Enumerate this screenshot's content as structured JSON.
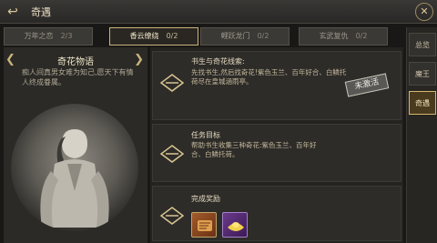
{
  "window": {
    "title": "奇遇"
  },
  "tabs": [
    {
      "label": "万年之恋",
      "count": "2/3",
      "active": false
    },
    {
      "label": "香云缭绕",
      "count": "0/2",
      "active": true
    },
    {
      "label": "鲤跃龙门",
      "count": "0/2",
      "active": false
    },
    {
      "label": "玄武复仇",
      "count": "0/2",
      "active": false
    }
  ],
  "story": {
    "title": "奇花物语",
    "text": "痴人间真男女难为知己,愿天下有情人终成眷属。"
  },
  "cards": {
    "clue": {
      "label": "书生与奇花线索:",
      "body": "先找书生,然后找奇花!紫色玉兰、百年好合、白鳞托荷尽在皇城涵雨亭。",
      "stamp": "未激活"
    },
    "goal": {
      "label": "任务目标",
      "body": "帮助书生收集三种奇花:紫色玉兰、百年好合、白鳞托荷。"
    },
    "reward": {
      "label": "完成奖励"
    }
  },
  "right_nav": [
    {
      "label": "总览",
      "active": false
    },
    {
      "label": "魔王",
      "active": false
    },
    {
      "label": "奇遇",
      "active": true
    }
  ]
}
